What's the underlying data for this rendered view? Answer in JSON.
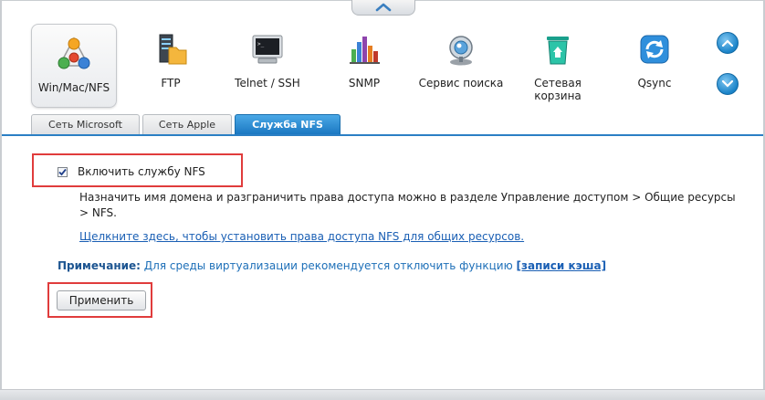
{
  "services": [
    {
      "label": "Win/Mac/NFS",
      "icon": "win-mac-nfs-icon",
      "active": true
    },
    {
      "label": "FTP",
      "icon": "ftp-folder-icon",
      "active": false
    },
    {
      "label": "Telnet / SSH",
      "icon": "terminal-icon",
      "active": false
    },
    {
      "label": "SNMP",
      "icon": "snmp-chart-icon",
      "active": false
    },
    {
      "label": "Сервис поиска",
      "icon": "search-service-icon",
      "active": false
    },
    {
      "label": "Сетевая корзина",
      "icon": "recycle-bin-icon",
      "active": false
    },
    {
      "label": "Qsync",
      "icon": "qsync-sync-icon",
      "active": false
    }
  ],
  "tabs": [
    {
      "label": "Сеть Microsoft",
      "active": false
    },
    {
      "label": "Сеть Apple",
      "active": false
    },
    {
      "label": "Служба NFS",
      "active": true
    }
  ],
  "nfs": {
    "enable_label": "Включить службу NFS",
    "enabled": true,
    "info": "Назначить имя домена и разграничить права доступа можно в разделе Управление доступом > Общие ресурсы > NFS.",
    "link": "Щелкните здесь, чтобы установить права доступа NFS для общих ресурсов.",
    "note_label": "Примечание:",
    "note_text": "Для среды виртуализации рекомендуется отключить функцию",
    "note_link": "[записи кэша]",
    "apply_label": "Применить"
  },
  "colors": {
    "accent": "#1b78c2",
    "highlight": "#e03c3c",
    "link": "#1a5fb4"
  }
}
